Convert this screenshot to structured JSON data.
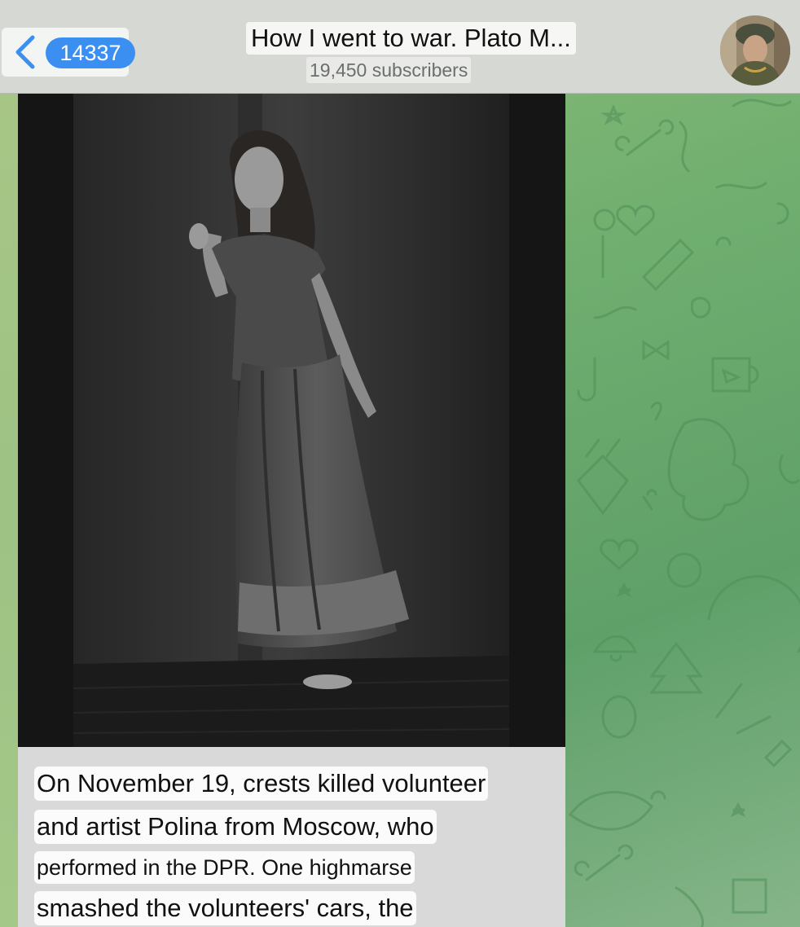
{
  "header": {
    "back_icon": "chevron-left-icon",
    "unread_count": "14337",
    "channel_title": "How I went to war. Plato M...",
    "subscribers": "19,450 subscribers",
    "avatar": "channel-avatar"
  },
  "message": {
    "photo": "black-and-white-portrait-photo",
    "caption_lines": [
      "On November 19, crests killed volunteer",
      "and artist Polina from Moscow, who",
      "performed in the DPR. One highmarse",
      "smashed the volunteers' cars, the"
    ]
  },
  "colors": {
    "badge": "#3b8ff0",
    "header_bg": "#d6d8d4",
    "chat_bg": "#6fae6f"
  }
}
